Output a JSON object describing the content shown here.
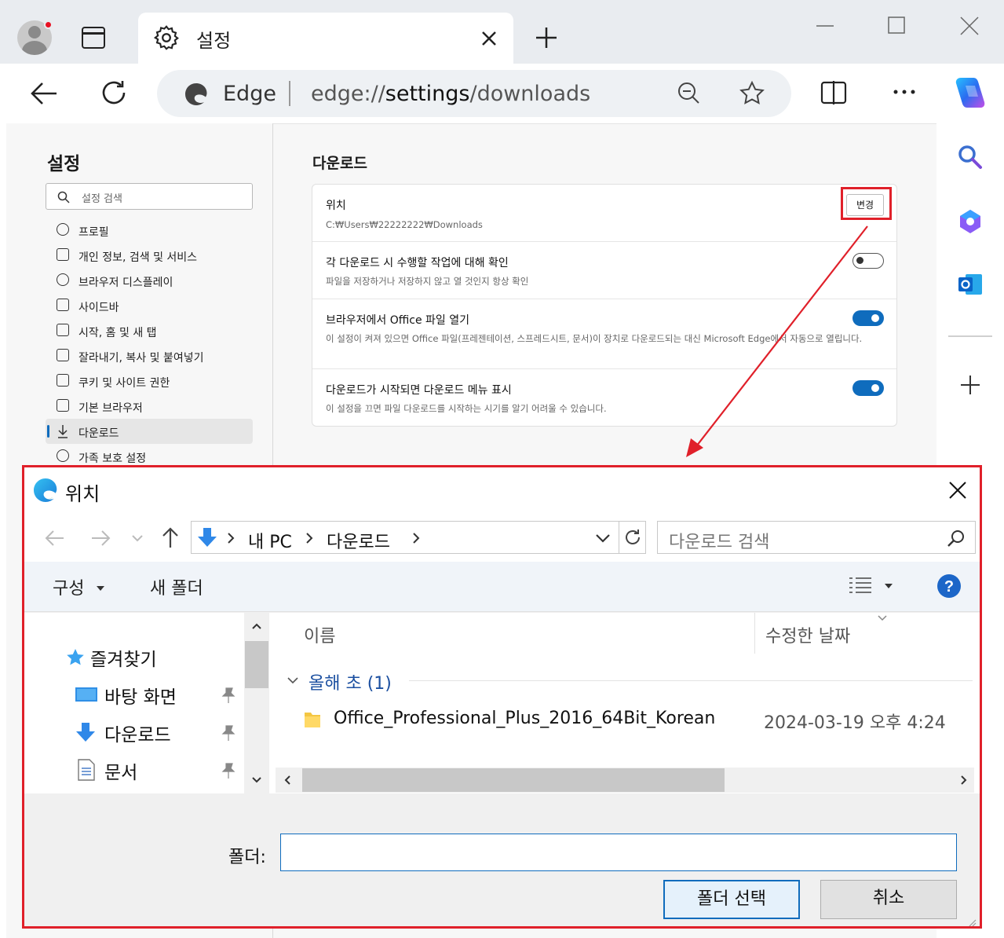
{
  "browser": {
    "tab_title": "설정",
    "address_brand": "Edge",
    "address_url_prefix": "edge://",
    "address_url_main": "settings",
    "address_url_suffix": "/downloads"
  },
  "settings": {
    "sidebar_title": "설정",
    "search_placeholder": "설정 검색",
    "nav": [
      {
        "label": "프로필",
        "icon": "profile-icon"
      },
      {
        "label": "개인 정보, 검색 및 서비스",
        "icon": "lock-icon"
      },
      {
        "label": "브라우저 디스플레이",
        "icon": "palette-icon"
      },
      {
        "label": "사이드바",
        "icon": "sidebar-icon"
      },
      {
        "label": "시작, 홈 및 새 탭",
        "icon": "home-icon"
      },
      {
        "label": "잘라내기, 복사 및 붙여넣기",
        "icon": "share-icon"
      },
      {
        "label": "쿠키 및 사이트 권한",
        "icon": "cookie-icon"
      },
      {
        "label": "기본 브라우저",
        "icon": "browser-icon"
      },
      {
        "label": "다운로드",
        "icon": "download-icon",
        "active": true
      },
      {
        "label": "가족 보호 설정",
        "icon": "family-icon"
      }
    ],
    "content_title": "다운로드",
    "location": {
      "title": "위치",
      "path": "C:₩Users₩22222222₩Downloads",
      "button": "변경"
    },
    "ask_each": {
      "title": "각 다운로드 시 수행할 작업에 대해 확인",
      "desc": "파일을 저장하거나 저장하지 않고 열 것인지 항상 확인",
      "on": false
    },
    "office": {
      "title": "브라우저에서 Office 파일 열기",
      "desc": "이 설정이 켜져 있으면 Office 파일(프레젠테이션, 스프레드시트, 문서)이 장치로 다운로드되는 대신 Microsoft Edge에서 자동으로 열립니다.",
      "on": true
    },
    "menu": {
      "title": "다운로드가 시작되면 다운로드 메뉴 표시",
      "desc": "이 설정을 끄면 파일 다운로드를 시작하는 시기를 알기 어려울 수 있습니다.",
      "on": true
    }
  },
  "dialog": {
    "title": "위치",
    "breadcrumb": [
      "내 PC",
      "다운로드"
    ],
    "search_placeholder": "다운로드 검색",
    "organize": "구성",
    "new_folder": "새 폴더",
    "tree": [
      {
        "label": "즐겨찾기",
        "icon": "star-icon"
      },
      {
        "label": "바탕 화면",
        "icon": "desktop-icon",
        "pinned": true
      },
      {
        "label": "다운로드",
        "icon": "download-arrow-icon",
        "pinned": true
      },
      {
        "label": "문서",
        "icon": "document-icon",
        "pinned": true
      }
    ],
    "columns": {
      "name": "이름",
      "modified": "수정한 날짜"
    },
    "group": {
      "label": "올해 초",
      "count": "(1)"
    },
    "file": {
      "name": "Office_Professional_Plus_2016_64Bit_Korean",
      "date": "2024-03-19 오후 4:24"
    },
    "folder_label": "폴더:",
    "folder_value": "",
    "select_button": "폴더 선택",
    "cancel_button": "취소"
  },
  "colors": {
    "accent": "#0f6cbd",
    "highlight": "#e0202a"
  }
}
